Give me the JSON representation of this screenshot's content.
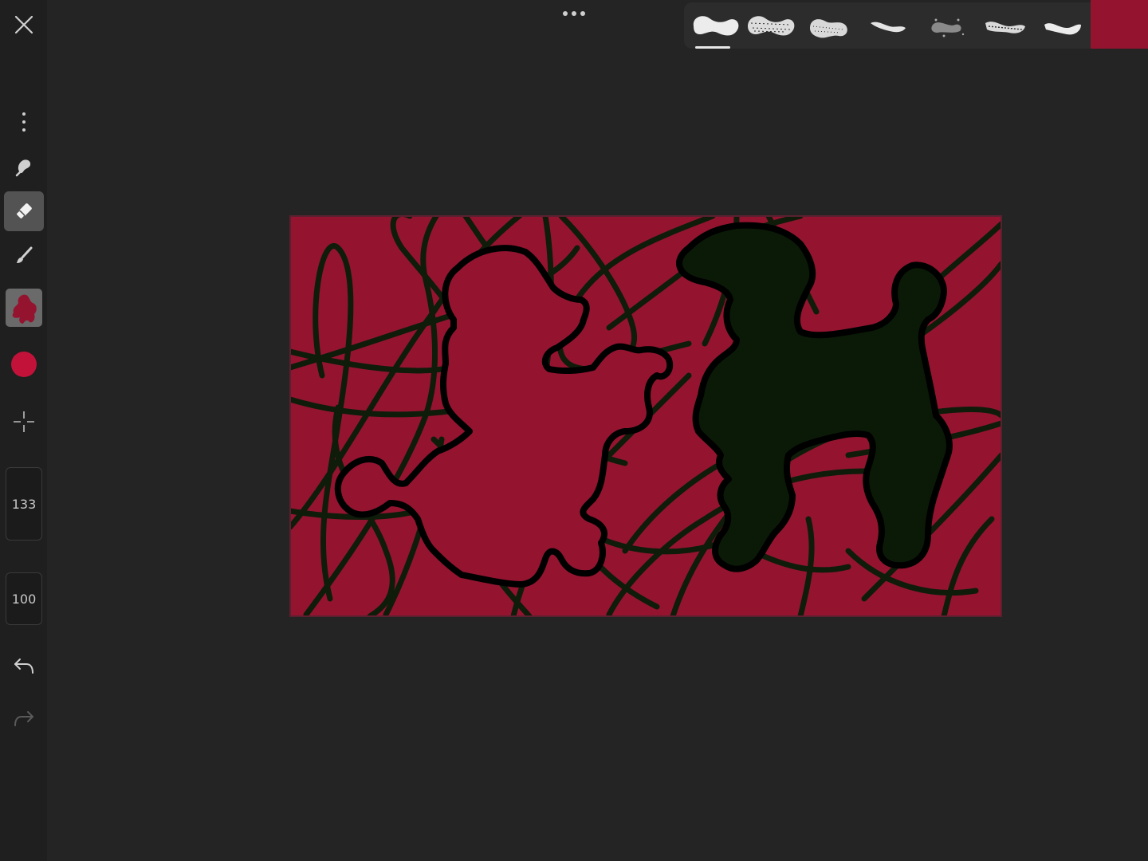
{
  "colors": {
    "current_color": "#941430",
    "background": "#242424",
    "sidebar": "#1f1f1f",
    "canvas_fill": "#941430",
    "stroke_color": "#0d1a08",
    "poodle_dark": "#0b1a07",
    "outline": "#000000"
  },
  "toolbar": {
    "close_icon": "close-icon",
    "more_icon": "vertical-ellipsis-icon",
    "smudge_icon": "smudge-icon",
    "eraser_icon": "eraser-icon",
    "brush_icon": "brush-icon",
    "layer_icon": "layer-thumbnail",
    "color_icon": "color-dot",
    "move_icon": "crosshair-icon",
    "size_value": "133",
    "opacity_value": "100",
    "undo_icon": "undo-icon",
    "redo_icon": "redo-icon",
    "active_tool": "eraser"
  },
  "top": {
    "options_icon": "horizontal-ellipsis-icon"
  },
  "brushes": [
    {
      "name": "round-brush",
      "selected": true
    },
    {
      "name": "dry-brush",
      "selected": false
    },
    {
      "name": "chalk-brush",
      "selected": false
    },
    {
      "name": "ink-brush",
      "selected": false
    },
    {
      "name": "splatter-brush",
      "selected": false
    },
    {
      "name": "textured-brush",
      "selected": false
    },
    {
      "name": "marker-brush",
      "selected": false
    }
  ]
}
